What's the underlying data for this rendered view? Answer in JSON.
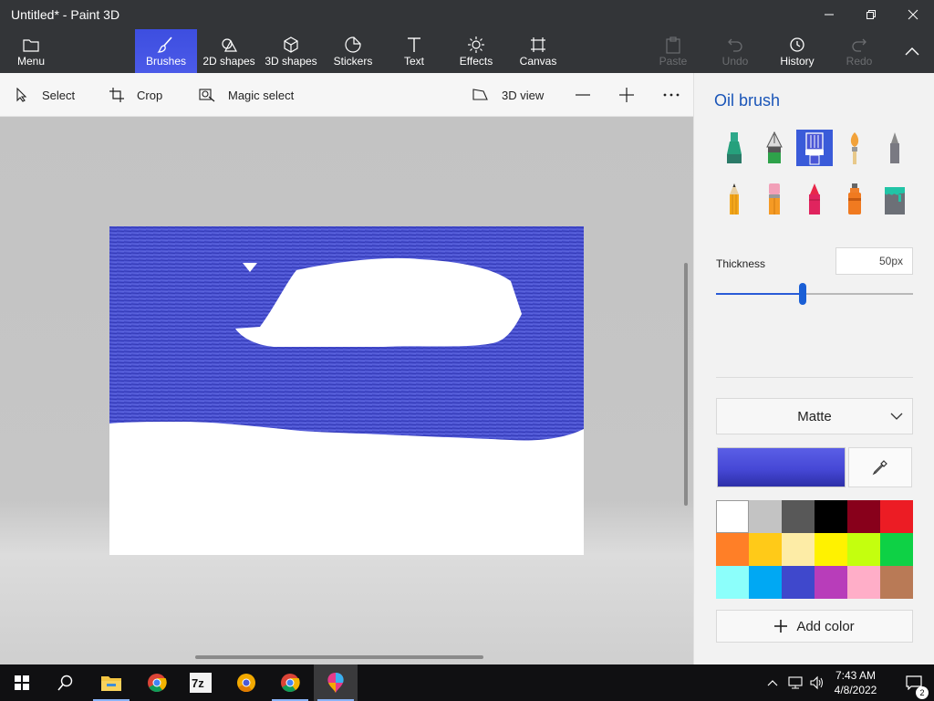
{
  "window": {
    "title": "Untitled* - Paint 3D"
  },
  "ribbon": {
    "menu": "Menu",
    "tabs": [
      "Brushes",
      "2D shapes",
      "3D shapes",
      "Stickers",
      "Text",
      "Effects",
      "Canvas"
    ],
    "actions": {
      "paste": "Paste",
      "undo": "Undo",
      "history": "History",
      "redo": "Redo"
    }
  },
  "toolbar": {
    "select": "Select",
    "crop": "Crop",
    "magic_select": "Magic select",
    "view3d": "3D view"
  },
  "panel": {
    "title": "Oil brush",
    "brushes": [
      "marker-icon",
      "calligraphy-pen-icon",
      "oil-brush-icon",
      "watercolor-icon",
      "pixel-pen-icon",
      "pencil-icon",
      "eraser-icon",
      "crayon-icon",
      "spray-can-icon",
      "fill-bucket-icon"
    ],
    "selected_brush": "oil-brush-icon",
    "thickness_label": "Thickness",
    "thickness_value": "50px",
    "thickness_fraction": 0.44,
    "finish": "Matte",
    "current_color": "#4648d6",
    "palette": [
      "#ffffff",
      "#c3c3c3",
      "#585858",
      "#000000",
      "#88001b",
      "#ec1c24",
      "#ff7f27",
      "#ffca18",
      "#fdeca6",
      "#fff200",
      "#c4ff0e",
      "#0ed145",
      "#8cfffb",
      "#00a8f3",
      "#3f48cc",
      "#b83dba",
      "#ffaec8",
      "#b97a56"
    ],
    "add_color": "Add color"
  },
  "taskbar": {
    "time": "7:43 AM",
    "date": "4/8/2022",
    "notifications": "2"
  }
}
